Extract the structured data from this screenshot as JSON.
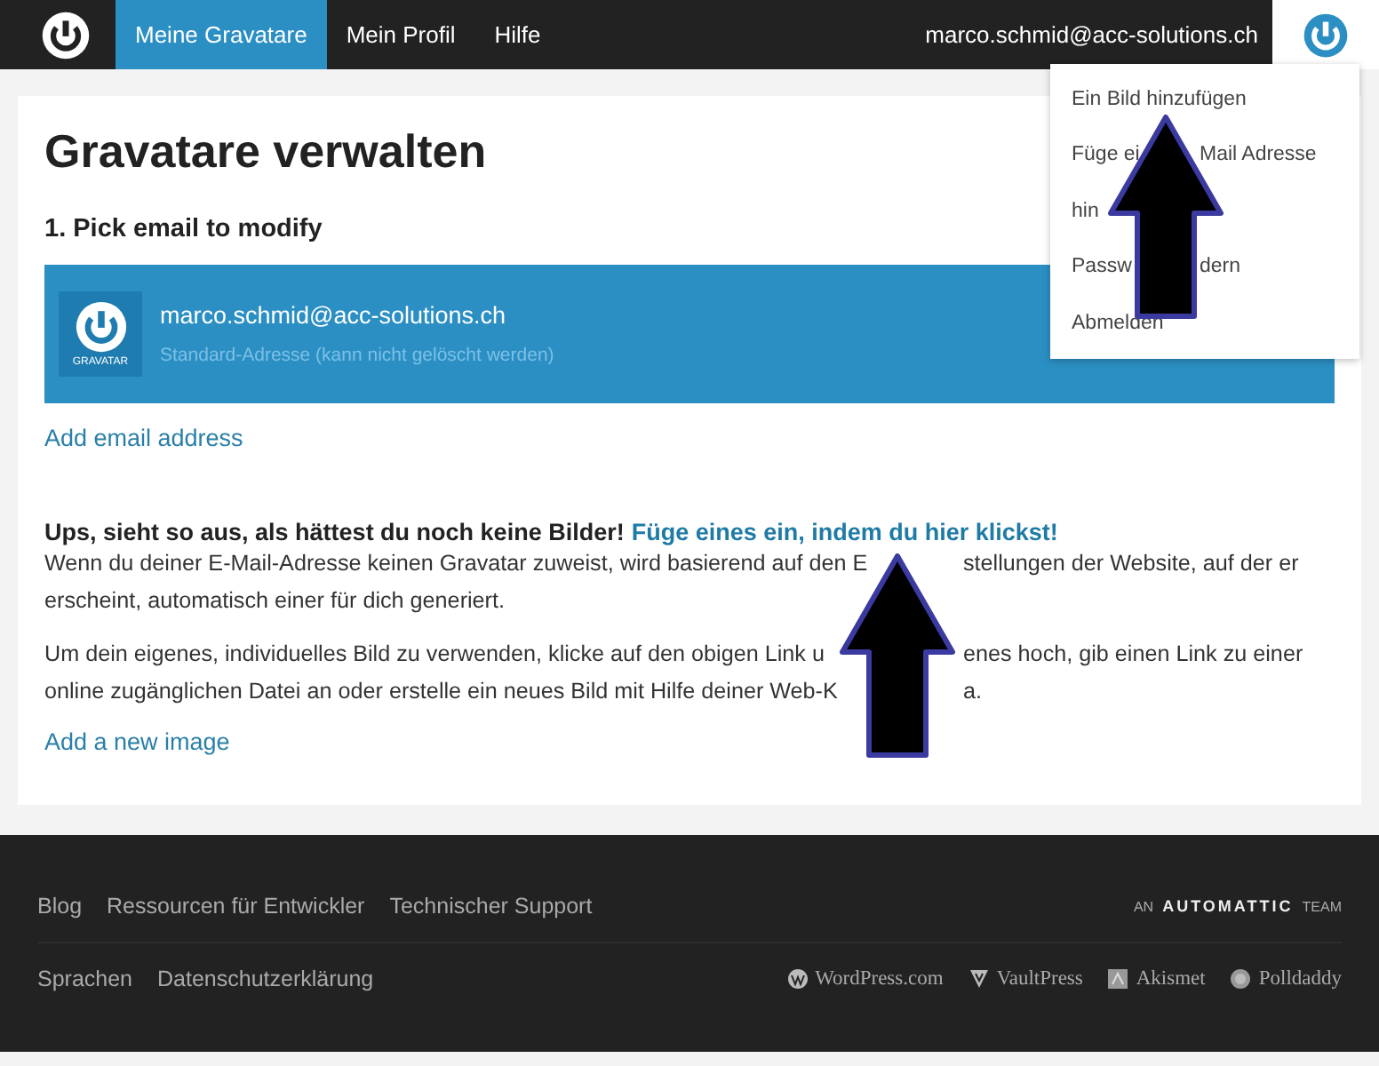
{
  "nav": {
    "items": [
      {
        "label": "Meine Gravatare",
        "selected": true
      },
      {
        "label": "Mein Profil",
        "selected": false
      },
      {
        "label": "Hilfe",
        "selected": false
      }
    ],
    "user": "marco.schmid@acc-solutions.ch"
  },
  "menu": {
    "items": [
      {
        "parts": [
          "Ein Bild hinzufügen"
        ]
      },
      {
        "parts": [
          "Füge ei",
          "Mail Adresse"
        ]
      },
      {
        "parts": [
          "hin"
        ]
      },
      {
        "parts": [
          "Passw",
          "dern"
        ]
      },
      {
        "parts": [
          "Abmelden"
        ]
      }
    ]
  },
  "page": {
    "title": "Gravatare verwalten",
    "step": "1. Pick email to modify",
    "emails": [
      {
        "address": "marco.schmid@acc-solutions.ch",
        "note": "Standard-Adresse (kann nicht gelöscht werden)",
        "badge": "GRAVATAR",
        "selected": true
      }
    ],
    "add_email": "Add email address",
    "notice": {
      "lead": "Ups, sieht so aus, als hättest du noch keine Bilder!",
      "link": "Füge eines ein, indem du hier klickst!"
    },
    "paragraphs": [
      {
        "lines": [
          [
            "Wenn du deiner E-Mail-Adresse keinen Gravatar zuweist, wird basierend auf den E",
            "stellungen der Website, auf der er"
          ],
          [
            "erscheint, automatisch einer für dich generiert."
          ]
        ]
      },
      {
        "lines": [
          [
            "Um dein eigenes, individuelles Bild zu verwenden, klicke auf den obigen Link u",
            "enes hoch, gib einen Link zu einer"
          ],
          [
            "online zugänglichen Datei an oder erstelle ein neues Bild mit Hilfe deiner Web-K",
            "a."
          ]
        ]
      }
    ],
    "add_image": "Add a new image"
  },
  "footer": {
    "links": [
      "Blog",
      "Ressourcen für Entwickler",
      "Technischer Support"
    ],
    "brand": {
      "prefix": "AN",
      "name": "AUTOMATTIC",
      "suffix": "TEAM"
    },
    "links_bottom": [
      "Sprachen",
      "Datenschutzerklärung"
    ],
    "products": [
      {
        "name": "WordPress.com",
        "kind": "wordpress"
      },
      {
        "name": "VaultPress",
        "kind": "vaultpress"
      },
      {
        "name": "Akismet",
        "kind": "akismet"
      },
      {
        "name": "Polldaddy",
        "kind": "polldaddy"
      }
    ]
  }
}
